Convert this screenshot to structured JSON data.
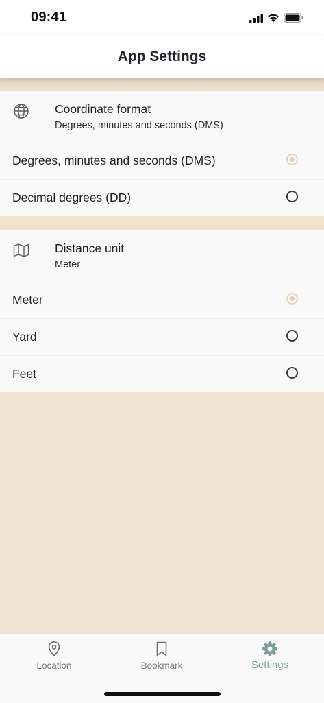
{
  "status_bar": {
    "time": "09:41"
  },
  "header": {
    "title": "App Settings"
  },
  "coordinate_section": {
    "icon": "globe-icon",
    "title": "Coordinate format",
    "subtitle": "Degrees, minutes and seconds (DMS)",
    "options": [
      {
        "label": "Degrees, minutes and seconds (DMS)",
        "selected": true
      },
      {
        "label": "Decimal degrees (DD)",
        "selected": false
      }
    ]
  },
  "distance_section": {
    "icon": "map-icon",
    "title": "Distance unit",
    "subtitle": "Meter",
    "options": [
      {
        "label": "Meter",
        "selected": true
      },
      {
        "label": "Yard",
        "selected": false
      },
      {
        "label": "Feet",
        "selected": false
      }
    ]
  },
  "tab_bar": {
    "tabs": [
      {
        "label": "Location",
        "icon": "location-pin-icon",
        "active": false
      },
      {
        "label": "Bookmark",
        "icon": "bookmark-icon",
        "active": false
      },
      {
        "label": "Settings",
        "icon": "gear-icon",
        "active": true
      }
    ]
  },
  "colors": {
    "background": "#EFE2CE",
    "radio_selected": "#E3CCAE",
    "tab_active": "#7FA09A"
  }
}
